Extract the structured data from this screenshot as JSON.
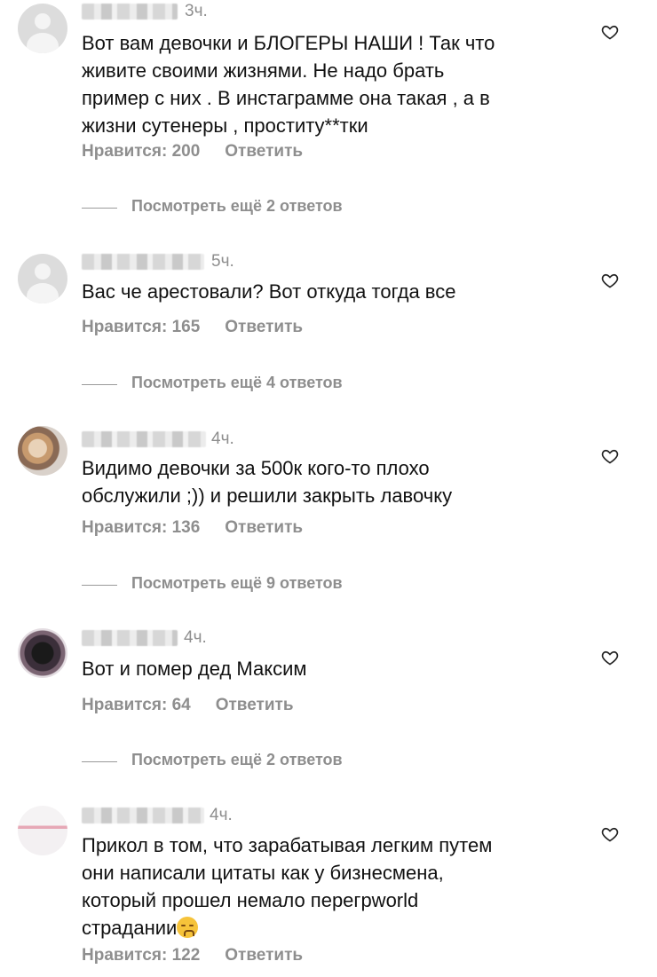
{
  "comments": [
    {
      "time": "3ч.",
      "text": "Вот вам девочки и БЛОГЕРЫ НАШИ ! Так что\nживите своими жизнями. Не надо брать\nпример с них . В инстаграмме она такая , а в\nжизни сутенеры , проститу**тки",
      "likes": "Нравится: 200",
      "reply": "Ответить",
      "view_replies": "Посмотреть ещё 2 ответов"
    },
    {
      "time": "5ч.",
      "text": "Вас че арестовали? Вот откуда тогда все",
      "likes": "Нравится: 165",
      "reply": "Ответить",
      "view_replies": "Посмотреть ещё 4 ответов"
    },
    {
      "time": "4ч.",
      "text": "Видимо девочки за 500к кого-то плохо\nобслужили ;)) и решили закрыть лавочку",
      "likes": "Нравится: 136",
      "reply": "Ответить",
      "view_replies": "Посмотреть ещё 9 ответов"
    },
    {
      "time": "4ч.",
      "text": "Вот и помер дед Максим",
      "likes": "Нравится: 64",
      "reply": "Ответить",
      "view_replies": "Посмотреть ещё 2 ответов"
    },
    {
      "time": "4ч.",
      "text": "Прикол в том, что зарабатывая легким путем\nони написали цитаты как у бизнесмена,\nкоторый прошел немало перегрworld\nстрадании",
      "likes": "Нравится: 122",
      "reply": "Ответить",
      "emoji": "sad-face-emoji"
    }
  ],
  "icons": {
    "like": "heart-outline-icon",
    "avatar_default": "default-avatar-icon"
  },
  "colors": {
    "secondary_text": "#8e8e8e",
    "primary_text": "#111111"
  }
}
